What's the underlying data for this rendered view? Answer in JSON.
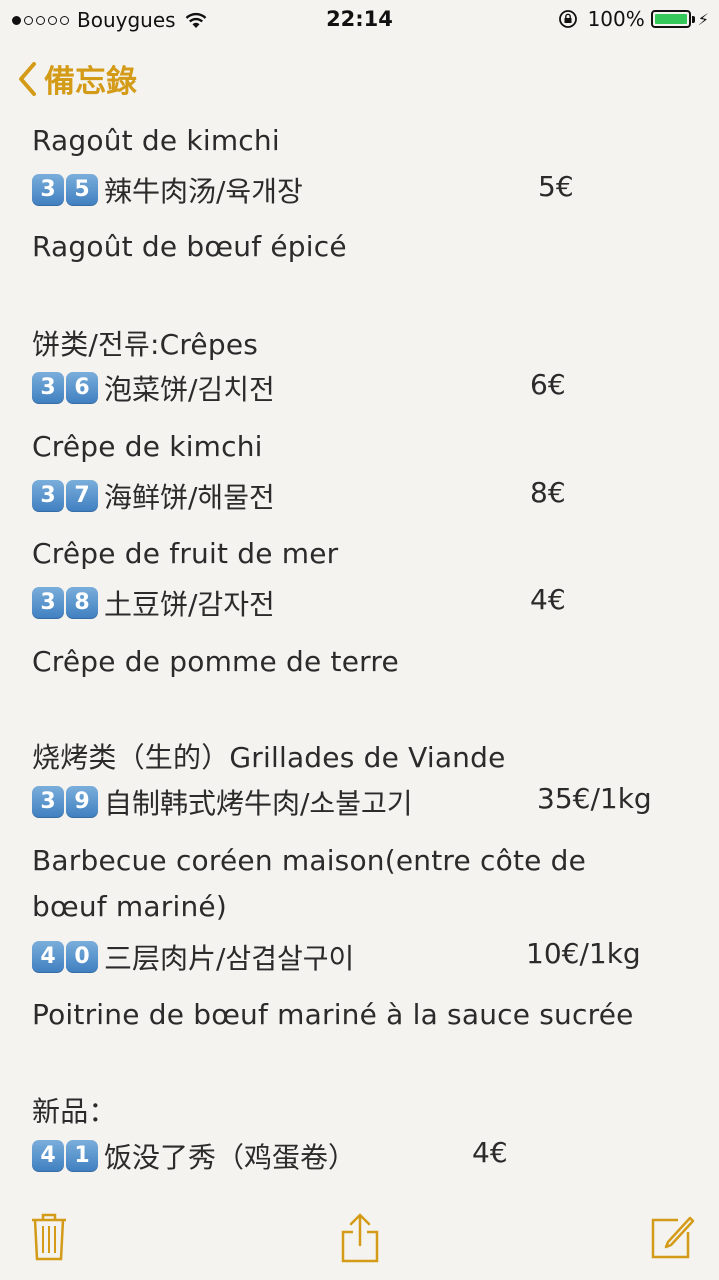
{
  "status_bar": {
    "carrier": "Bouygues",
    "time": "22:14",
    "battery": "100%",
    "battery_level": 1.0
  },
  "nav": {
    "back_label": "備忘錄"
  },
  "accent_color": "#d39b18",
  "note": {
    "lines": [
      {
        "kind": "text",
        "text": "Ragoût de kimchi"
      },
      {
        "kind": "item",
        "digits": [
          "3",
          "5"
        ],
        "name": "辣牛肉汤/육개장",
        "price": "5€"
      },
      {
        "kind": "text",
        "text": "Ragoût de bœuf épicé"
      },
      {
        "kind": "text",
        "text": "饼类/전류:Crêpes"
      },
      {
        "kind": "item",
        "digits": [
          "3",
          "6"
        ],
        "name": "泡菜饼/김치전",
        "price": "6€"
      },
      {
        "kind": "text",
        "text": "Crêpe de kimchi"
      },
      {
        "kind": "item",
        "digits": [
          "3",
          "7"
        ],
        "name": "海鲜饼/해물전",
        "price": "8€"
      },
      {
        "kind": "text",
        "text": "Crêpe de fruit de mer"
      },
      {
        "kind": "item",
        "digits": [
          "3",
          "8"
        ],
        "name": "土豆饼/감자전",
        "price": "4€"
      },
      {
        "kind": "text",
        "text": "Crêpe de pomme de terre"
      },
      {
        "kind": "text",
        "text": "烧烤类（生的）Grillades de Viande"
      },
      {
        "kind": "item",
        "digits": [
          "3",
          "9"
        ],
        "name": "自制韩式烤牛肉/소불고기",
        "price": "35€/1kg"
      },
      {
        "kind": "text",
        "text": "Barbecue coréen maison(entre côte de"
      },
      {
        "kind": "text",
        "text": "bœuf mariné)"
      },
      {
        "kind": "item",
        "digits": [
          "4",
          "0"
        ],
        "name": "三层肉片/삼겹살구이",
        "price": "10€/1kg"
      },
      {
        "kind": "text",
        "text": "Poitrine de bœuf mariné à la sauce sucrée"
      },
      {
        "kind": "text",
        "text": "新品："
      },
      {
        "kind": "item",
        "digits": [
          "4",
          "1"
        ],
        "name": "饭没了秀（鸡蛋卷）",
        "price": "4€"
      }
    ]
  },
  "toolbar": {
    "icons": [
      "trash-icon",
      "share-icon",
      "compose-icon"
    ]
  }
}
